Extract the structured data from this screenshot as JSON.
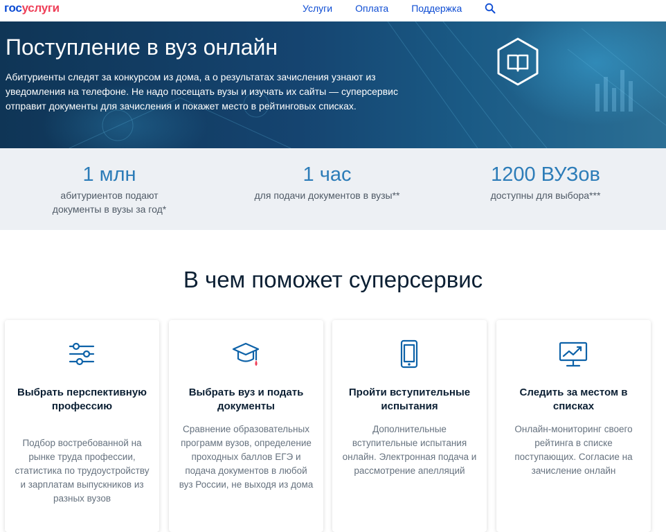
{
  "header": {
    "logo_part1": "гос",
    "logo_part2": "услуги",
    "nav": [
      "Услуги",
      "Оплата",
      "Поддержка"
    ],
    "search_icon": "search-icon"
  },
  "hero": {
    "title": "Поступление в вуз онлайн",
    "text": "Абитуриенты следят за конкурсом из дома, а о результатах зачисления узнают из уведомления на телефоне. Не надо посещать вузы и изучать их сайты — суперсервис отправит документы для зачисления и покажет место в рейтинговых списках.",
    "icon": "book-icon"
  },
  "stats": [
    {
      "value": "1 млн",
      "caption": "абитуриентов подают документы в вузы за год*"
    },
    {
      "value": "1 час",
      "caption": "для подачи документов в вузы**"
    },
    {
      "value": "1200 ВУЗов",
      "caption": "доступны для выбора***"
    }
  ],
  "section": {
    "title": "В чем поможет суперсервис"
  },
  "cards": [
    {
      "icon": "sliders-icon",
      "title": "Выбрать перспективную профессию",
      "text": "Подбор востребованной на рынке труда профессии, статистика по трудоустройству и зарплатам выпускников из разных вузов"
    },
    {
      "icon": "graduation-cap-icon",
      "title": "Выбрать вуз и подать документы",
      "text": "Сравнение образовательных программ вузов, определение проходных баллов ЕГЭ и подача документов в любой вуз России, не выходя из дома"
    },
    {
      "icon": "phone-icon",
      "title": "Пройти вступительные испытания",
      "text": "Дополнительные вступительные испытания онлайн. Электронная подача и рассмотрение апелляций"
    },
    {
      "icon": "monitor-chart-icon",
      "title": "Следить за местом в списках",
      "text": "Онлайн-мониторинг своего рейтинга в списке поступающих. Согласие на зачисление онлайн"
    }
  ],
  "colors": {
    "accent": "#0d4cd3",
    "logo_red": "#ee3f58",
    "stat_blue": "#2c7cb8",
    "icon_blue": "#0d62a8"
  }
}
